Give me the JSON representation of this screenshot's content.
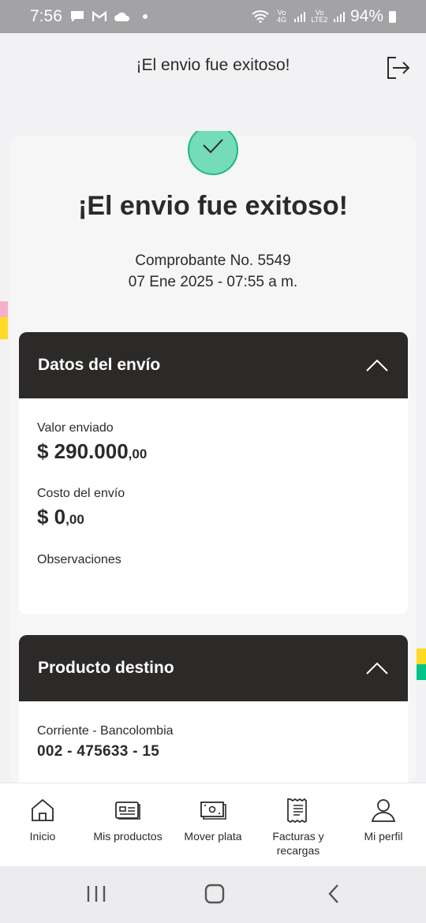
{
  "status_bar": {
    "time": "7:56",
    "battery": "94%",
    "left_icons": [
      "message-icon",
      "gmail-icon",
      "cloud-icon",
      "dot-icon"
    ],
    "right_icons": [
      "wifi-icon",
      "volte-icon",
      "signal-icon",
      "lte-icon",
      "signal-icon"
    ],
    "volte_label": "Vo 4G",
    "lte_label": "Vo LTE2"
  },
  "header": {
    "title": "¡El envio fue exitoso!"
  },
  "success": {
    "title": "¡El envio fue exitoso!",
    "voucher": "Comprobante No. 5549",
    "date": "07 Ene 2025 - 07:55 a m."
  },
  "shipment": {
    "title": "Datos del envío",
    "sent_label": "Valor enviado",
    "sent_value": "$ 290.000",
    "sent_cents": ",00",
    "cost_label": "Costo del envío",
    "cost_value": "$ 0",
    "cost_cents": ",00",
    "notes_label": "Observaciones"
  },
  "destination": {
    "title": "Producto destino",
    "account_type": "Corriente - Bancolombia",
    "account_number": "002 - 475633 - 15"
  },
  "nav": {
    "items": [
      {
        "label": "Inicio",
        "icon": "home-icon"
      },
      {
        "label": "Mis productos",
        "icon": "wallet-icon"
      },
      {
        "label": "Mover plata",
        "icon": "money-icon"
      },
      {
        "label": "Facturas y recargas",
        "icon": "receipt-icon"
      },
      {
        "label": "Mi perfil",
        "icon": "profile-icon"
      }
    ]
  },
  "colors": {
    "dark": "#2c2a29",
    "success_green": "#74dcb8",
    "accent_yellow": "#fdda24",
    "accent_pink": "#f7aecb",
    "accent_green": "#00c389"
  }
}
